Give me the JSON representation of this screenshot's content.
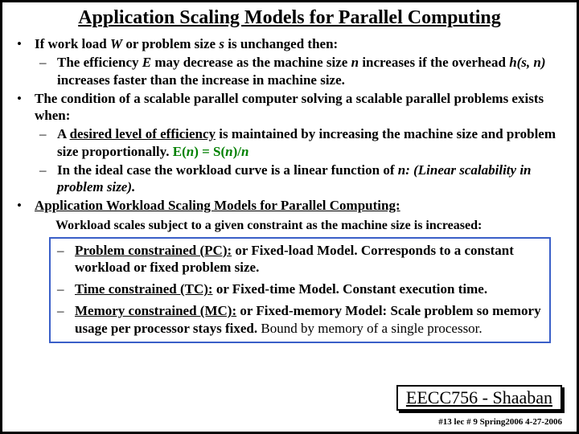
{
  "title": "Application Scaling Models for Parallel Computing",
  "b1": {
    "lead": "If work load  ",
    "w": "W",
    "mid1": "  or problem size  ",
    "s": "s",
    "tail": "  is unchanged then:",
    "sub1a": "The efficiency  ",
    "sub1E": "E",
    "sub1b": "  may decrease as the machine size ",
    "sub1n": "n",
    "sub1c": " increases if the overhead  ",
    "sub1h": "h(s, n)",
    "sub1d": "  increases faster than the increase in machine size."
  },
  "b2": {
    "text": "The condition of a scalable parallel computer solving a scalable parallel problems exists when:",
    "sub1a": "A ",
    "sub1u": "desired level of efficiency",
    "sub1b": " is maintained by increasing the machine size and problem size proportionally.   ",
    "eqE": "E(",
    "eqn1": "n",
    "eqMid": ")   =  S(",
    "eqn2": "n",
    "eqSlash": ")/",
    "eqn3": "n",
    "sub2a": "In the ideal case the workload curve is a linear function of ",
    "sub2n": "n: ",
    "sub2b": "(Linear scalability in problem size)."
  },
  "b3": {
    "heading": "Application Workload Scaling Models for Parallel Computing:",
    "note": "Workload scales subject to a given constraint as the machine size is increased:",
    "pcL": "Problem constrained (PC):",
    "pcR": "  or Fixed-load Model.  Corresponds to a constant workload or fixed problem size.",
    "tcL": "Time constrained (TC):",
    "tcR": "  or Fixed-time Model.  Constant execution time.",
    "mcL": "Memory constrained (MC):",
    "mcR1": "  or Fixed-memory Model:  Scale problem so memory usage per processor stays fixed.",
    "mcR2": "  Bound  by memory of a single processor."
  },
  "footer": {
    "box": "EECC756 - Shaaban",
    "page": "#13  lec # 9   Spring2006  4-27-2006"
  }
}
